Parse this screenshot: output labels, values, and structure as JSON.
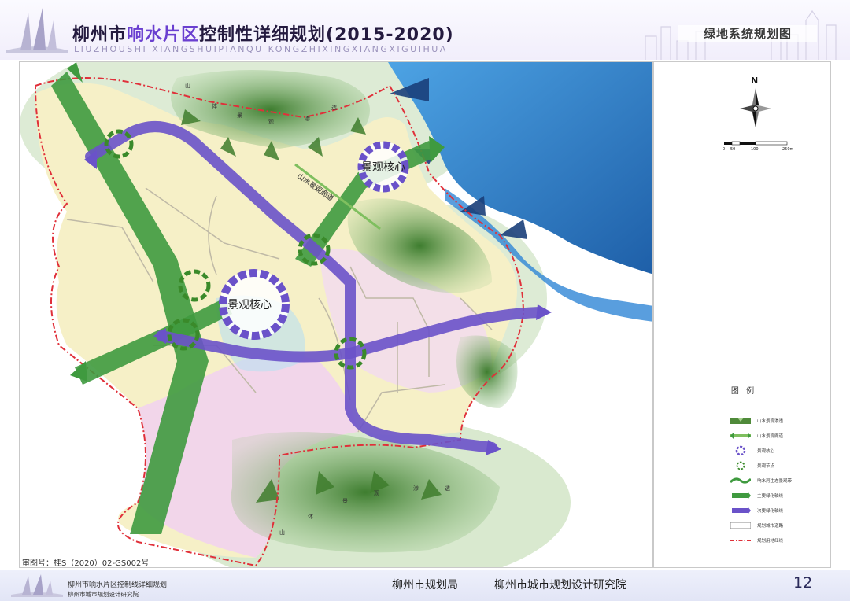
{
  "header": {
    "title_prefix": "柳州市",
    "title_highlight": "响水片区",
    "title_suffix": "控制性详细规划(2015-2020)",
    "subtitle": "LIUZHOUSHI XIANGSHUIPIANQU KONGZHIXINGXIANGXIGUIHUA",
    "section_title": "绿地系统规划图"
  },
  "map": {
    "core_labels": [
      "景观核心",
      "景观核心"
    ],
    "corridor_label": "山水景观廊道",
    "place_labels": [
      "山",
      "体",
      "景",
      "观",
      "渗",
      "透"
    ],
    "colors": {
      "water": "#2f6fb5",
      "green_axis": "#3f9a3f",
      "purple_axis": "#6a52c9",
      "boundary": "#e0303a",
      "mountain": "#4f8a3a"
    }
  },
  "compass": {
    "north": "N"
  },
  "scale": {
    "labels": [
      "0",
      "50",
      "100",
      "250m"
    ]
  },
  "legend": {
    "title": "图 例",
    "items": [
      "山水景观渗透",
      "山水景观廊道",
      "景观核心",
      "景观节点",
      "响水河生态景观带",
      "主要绿化轴线",
      "次要绿化轴线",
      "规划城市道路",
      "规划用地红线"
    ]
  },
  "approval_no": "审图号：桂S（2020）02-GS002号",
  "footer": {
    "line1": "柳州市响水片区控制线详细规划",
    "line2": "柳州市城市规划设计研究院",
    "org1": "柳州市规划局",
    "org2": "柳州市城市规划设计研究院",
    "page": "12"
  }
}
